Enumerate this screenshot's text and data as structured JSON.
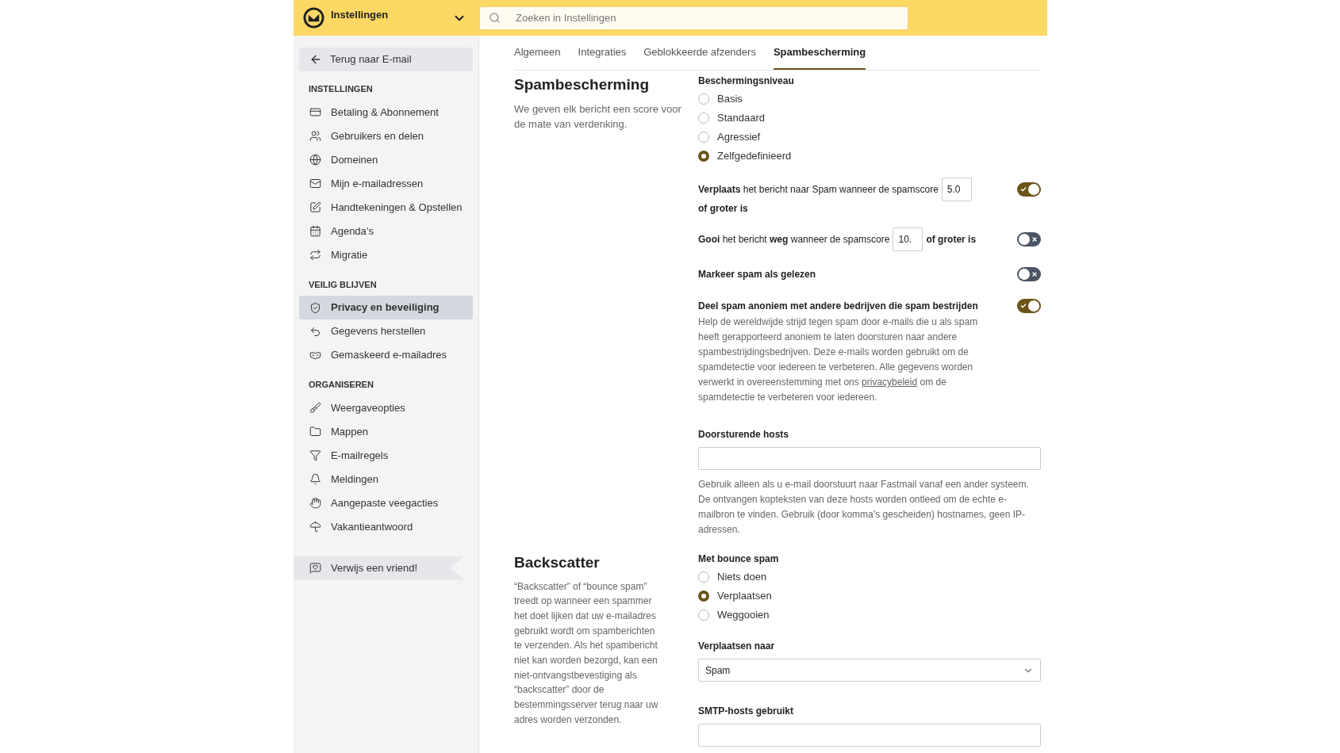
{
  "top_bar": {
    "title": "Instellingen",
    "search": {
      "placeholder": "Zoeken in Instellingen"
    }
  },
  "sidebar": {
    "back": "Terug naar E-mail",
    "sections": [
      {
        "heading": "INSTELLINGEN",
        "items": [
          {
            "label": "Betaling & Abonnement",
            "selected": false
          },
          {
            "label": "Gebruikers en delen",
            "selected": false
          },
          {
            "label": "Domeinen",
            "selected": false
          },
          {
            "label": "Mijn e-mailadressen",
            "selected": false
          },
          {
            "label": "Handtekeningen & Opstellen",
            "selected": false
          },
          {
            "label": "Agenda’s",
            "selected": false
          },
          {
            "label": "Migratie",
            "selected": false
          }
        ]
      },
      {
        "heading": "VEILIG BLIJVEN",
        "items": [
          {
            "label": "Privacy en beveiliging",
            "selected": true
          },
          {
            "label": "Gegevens herstellen",
            "selected": false
          },
          {
            "label": "Gemaskeerd e-mailadres",
            "selected": false
          }
        ]
      },
      {
        "heading": "ORGANISEREN",
        "items": [
          {
            "label": "Weergaveopties",
            "selected": false
          },
          {
            "label": "Mappen",
            "selected": false
          },
          {
            "label": "E-mailregels",
            "selected": false
          },
          {
            "label": "Meldingen",
            "selected": false
          },
          {
            "label": "Aangepaste veegacties",
            "selected": false
          },
          {
            "label": "Vakantieantwoord",
            "selected": false
          }
        ]
      }
    ],
    "refer": "Verwijs een vriend!"
  },
  "tabs": [
    {
      "label": "Algemeen",
      "selected": false
    },
    {
      "label": "Integraties",
      "selected": false
    },
    {
      "label": "Geblokkeerde afzenders",
      "selected": false
    },
    {
      "label": "Spambescherming",
      "selected": true
    }
  ],
  "spam": {
    "title": "Spambescherming",
    "intro": "We geven elk bericht een score voor de mate van verdenking.",
    "level_label": "Beschermingsniveau",
    "levels": [
      {
        "label": "Basis",
        "selected": false
      },
      {
        "label": "Standaard",
        "selected": false
      },
      {
        "label": "Agressief",
        "selected": false
      },
      {
        "label": "Zelfgedefinieerd",
        "selected": true
      }
    ],
    "rules": [
      {
        "kind": "score",
        "before": "**Verplaats** het bericht naar Spam wanneer de spamscore",
        "value": "5.0",
        "after": "of groter is",
        "on": true
      },
      {
        "kind": "score",
        "before": "**Gooi** het bericht **weg** wanneer de spamscore",
        "value": "10.",
        "after": "of groter is",
        "on": false
      },
      {
        "kind": "plain",
        "label": "Markeer spam als gelezen",
        "on": false
      },
      {
        "kind": "described",
        "label": "Deel spam anoniem met andere bedrijven die spam bestrijden",
        "on": true,
        "description_before": "Help de wereldwijde strijd tegen spam door e-mails die u als spam heeft gerapporteerd anoniem te laten doorsturen naar andere spambestrijdingsbedrijven. Deze e-mails worden gebruikt om de spamdetectie voor iedereen te verbeteren. Alle gegevens worden verwerkt in overeenstemming met ons",
        "link": "privacybeleid",
        "description_after": "om de spamdetectie te verbeteren voor iedereen."
      }
    ],
    "hosts_label": "Doorsturende hosts",
    "hosts_help": "Gebruik alleen als u e-mail doorstuurt naar Fastmail vanaf een ander systeem. De ontvangen kopteksten van deze hosts worden ontleed om de echte e-mailbron te vinden. Gebruik (door komma’s gescheiden) hostnames, geen IP-adressen."
  },
  "backscatter": {
    "title": "Backscatter",
    "intro": "“Backscatter” of “bounce spam” treedt op wanneer een spammer het doet lijken dat uw e-mailadres gebruikt wordt om spamberichten te verzenden. Als het spambericht niet kan worden bezorgd, kan een niet-ontvangstbevestiging als “backscatter” door de bestemmingsserver terug naar uw adres worden verzonden.",
    "bounce_label": "Met bounce spam",
    "options": [
      {
        "label": "Niets doen",
        "selected": false
      },
      {
        "label": "Verplaatsen",
        "selected": true
      },
      {
        "label": "Weggooien",
        "selected": false
      }
    ],
    "move_label": "Verplaatsen naar",
    "move_value": "Spam",
    "smtp_label": "SMTP-hosts gebruikt"
  }
}
